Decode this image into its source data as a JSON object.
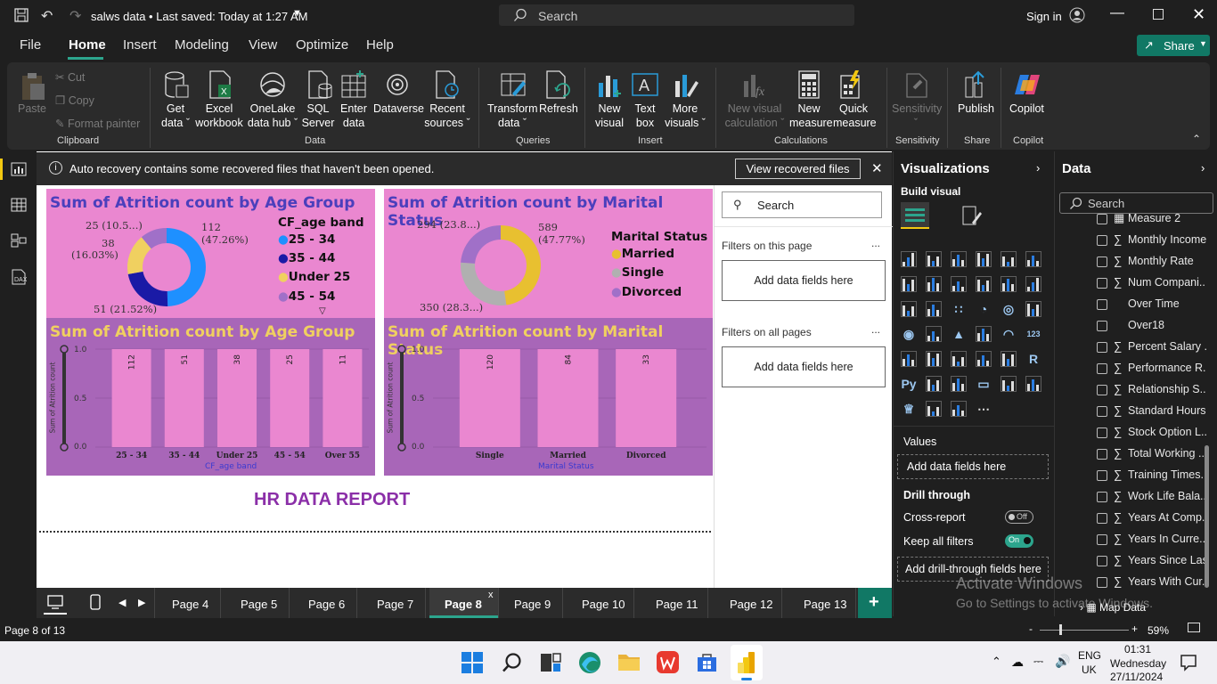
{
  "titlebar": {
    "title": "salws data • Last saved: Today at 1:27 AM",
    "search_placeholder": "Search",
    "sign_in": "Sign in"
  },
  "menu": [
    "File",
    "Home",
    "Insert",
    "Modeling",
    "View",
    "Optimize",
    "Help"
  ],
  "share_label": "Share",
  "ribbon": {
    "clipboard": {
      "paste": "Paste",
      "cut": "Cut",
      "copy": "Copy",
      "format_painter": "Format painter",
      "group": "Clipboard"
    },
    "data": {
      "get_data": [
        "Get",
        "data"
      ],
      "excel": [
        "Excel",
        "workbook"
      ],
      "onelake": [
        "OneLake",
        "data hub"
      ],
      "sql": [
        "SQL",
        "Server"
      ],
      "enter": [
        "Enter",
        "data"
      ],
      "dataverse": "Dataverse",
      "recent": [
        "Recent",
        "sources"
      ],
      "group": "Data"
    },
    "queries": {
      "transform": [
        "Transform",
        "data"
      ],
      "refresh": "Refresh",
      "group": "Queries"
    },
    "insert": {
      "new_visual": [
        "New",
        "visual"
      ],
      "text_box": [
        "Text",
        "box"
      ],
      "more_visuals": [
        "More",
        "visuals"
      ],
      "group": "Insert"
    },
    "calculations": {
      "new_visual_calc": [
        "New visual",
        "calculation"
      ],
      "new_measure": [
        "New",
        "measure"
      ],
      "quick_measure": [
        "Quick",
        "measure"
      ],
      "group": "Calculations"
    },
    "sensitivity": {
      "label": "Sensitivity",
      "group": "Sensitivity"
    },
    "share": {
      "publish": "Publish",
      "group": "Share"
    },
    "copilot": {
      "label": "Copilot",
      "group": "Copilot"
    }
  },
  "recovery": {
    "message": "Auto recovery contains some recovered files that haven't been opened.",
    "button": "View recovered files"
  },
  "report": {
    "donut1": {
      "title": "Sum of Atrition count by Age Group",
      "legend_title": "CF_age band",
      "legend": [
        "25 - 34",
        "35 - 44",
        "Under 25",
        "45 - 54"
      ],
      "labels": [
        "112",
        "(47.26%)",
        "51 (21.52%)",
        "38",
        "(16.03%)",
        "25 (10.5...)"
      ]
    },
    "donut2": {
      "title": "Sum of Atrition count by Marital Status",
      "legend_title": "Marital Status",
      "legend": [
        "Married",
        "Single",
        "Divorced"
      ],
      "labels": [
        "589",
        "(47.77%)",
        "350 (28.3...)",
        "294 (23.8...)"
      ]
    },
    "bar1": {
      "title": "Sum of Atrition count by Age Group",
      "ylabel": "Sum of Atrition count",
      "xlabel": "CF_age band",
      "yticks": [
        "1.0",
        "0.5",
        "0.0"
      ]
    },
    "bar2": {
      "title": "Sum of Atrition count by Marital Status",
      "ylabel": "Sum of Atrition count",
      "xlabel": "Marital Status",
      "yticks": [
        "1.0",
        "0.5",
        "0.0"
      ]
    },
    "report_title": "HR DATA REPORT"
  },
  "chart_data": [
    {
      "type": "pie",
      "title": "Sum of Atrition count by Age Group",
      "categories": [
        "25 - 34",
        "35 - 44",
        "Under 25",
        "45 - 54"
      ],
      "values": [
        112,
        51,
        38,
        25
      ],
      "colors": [
        "#1e90ff",
        "#1a1aa6",
        "#f0d060",
        "#a070c8"
      ]
    },
    {
      "type": "pie",
      "title": "Sum of Atrition count by Marital Status",
      "categories": [
        "Married",
        "Single",
        "Divorced"
      ],
      "values": [
        589,
        350,
        294
      ],
      "colors": [
        "#e8c030",
        "#b0b0b0",
        "#a070c8"
      ]
    },
    {
      "type": "bar",
      "title": "Sum of Atrition count by Age Group",
      "categories": [
        "25 - 34",
        "35 - 44",
        "Under 25",
        "45 - 54",
        "Over 55"
      ],
      "values": [
        112,
        51,
        38,
        25,
        11
      ],
      "xlabel": "CF_age band",
      "ylabel": "Sum of Atrition count"
    },
    {
      "type": "bar",
      "title": "Sum of Atrition count by Marital Status",
      "categories": [
        "Single",
        "Married",
        "Divorced"
      ],
      "values": [
        120,
        84,
        33
      ],
      "xlabel": "Marital Status",
      "ylabel": "Sum of Atrition count"
    }
  ],
  "filters": {
    "search": "Search",
    "this_page": "Filters on this page",
    "all_pages": "Filters on all pages",
    "add": "Add data fields here",
    "more": "..."
  },
  "visualizations": {
    "title": "Visualizations",
    "build": "Build visual",
    "values": "Values",
    "add_values": "Add data fields here",
    "drill": "Drill through",
    "cross_report": "Cross-report",
    "cross_state": "Off",
    "keep_filters": "Keep all filters",
    "keep_state": "On",
    "add_drill": "Add drill-through fields here",
    "more": "..."
  },
  "data_pane": {
    "title": "Data",
    "search": "Search",
    "fields": [
      {
        "sig": "▦",
        "name": "Measure 2"
      },
      {
        "sig": "∑",
        "name": "Monthly Income"
      },
      {
        "sig": "∑",
        "name": "Monthly Rate"
      },
      {
        "sig": "∑",
        "name": "Num Compani..."
      },
      {
        "sig": "",
        "name": "Over Time"
      },
      {
        "sig": "",
        "name": "Over18"
      },
      {
        "sig": "∑",
        "name": "Percent Salary ..."
      },
      {
        "sig": "∑",
        "name": "Performance R..."
      },
      {
        "sig": "∑",
        "name": "Relationship S..."
      },
      {
        "sig": "∑",
        "name": "Standard Hours"
      },
      {
        "sig": "∑",
        "name": "Stock Option L..."
      },
      {
        "sig": "∑",
        "name": "Total Working ..."
      },
      {
        "sig": "∑",
        "name": "Training Times..."
      },
      {
        "sig": "∑",
        "name": "Work Life Bala..."
      },
      {
        "sig": "∑",
        "name": "Years At Comp..."
      },
      {
        "sig": "∑",
        "name": "Years In Curre..."
      },
      {
        "sig": "∑",
        "name": "Years Since Las..."
      },
      {
        "sig": "∑",
        "name": "Years With Cur..."
      }
    ],
    "map_data": "Map Data"
  },
  "pages": [
    "Page 4",
    "Page 5",
    "Page 6",
    "Page 7",
    "Page 8",
    "Page 9",
    "Page 10",
    "Page 11",
    "Page 12",
    "Page 13"
  ],
  "active_page": "Page 8",
  "close_x": "x",
  "status": {
    "page": "Page 8 of 13",
    "zoom": "59%"
  },
  "watermark": {
    "line1": "Activate Windows",
    "line2": "Go to Settings to activate Windows."
  },
  "taskbar": {
    "lang1": "ENG",
    "lang2": "UK",
    "time": "01:31",
    "day": "Wednesday",
    "date": "27/11/2024"
  }
}
